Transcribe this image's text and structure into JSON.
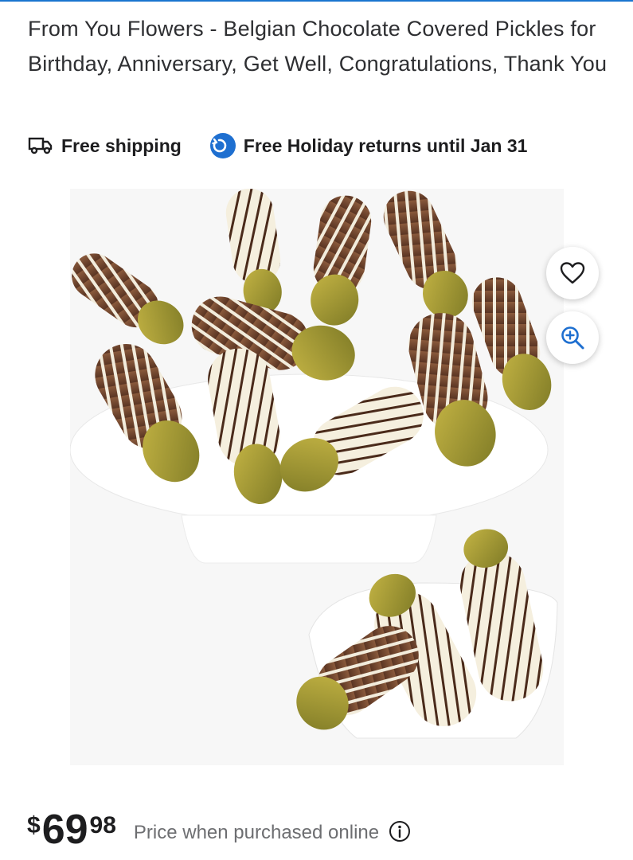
{
  "product": {
    "title": "From You Flowers - Belgian Chocolate Covered Pickles for Birthday, Anniversary, Get Well, Congratulations, Thank You"
  },
  "badges": {
    "shipping": {
      "label": "Free shipping",
      "icon": "truck-icon"
    },
    "returns": {
      "label": "Free Holiday returns until Jan 31",
      "icon": "return-arrow-icon"
    }
  },
  "image": {
    "description_icon_actions": [
      "heart-icon",
      "zoom-in-icon"
    ]
  },
  "price": {
    "currency": "$",
    "dollars": "69",
    "cents": "98",
    "note": "Price when purchased online"
  },
  "colors": {
    "accent": "#1e6fd0",
    "text": "#2e2f32",
    "muted": "#6d6e71"
  }
}
